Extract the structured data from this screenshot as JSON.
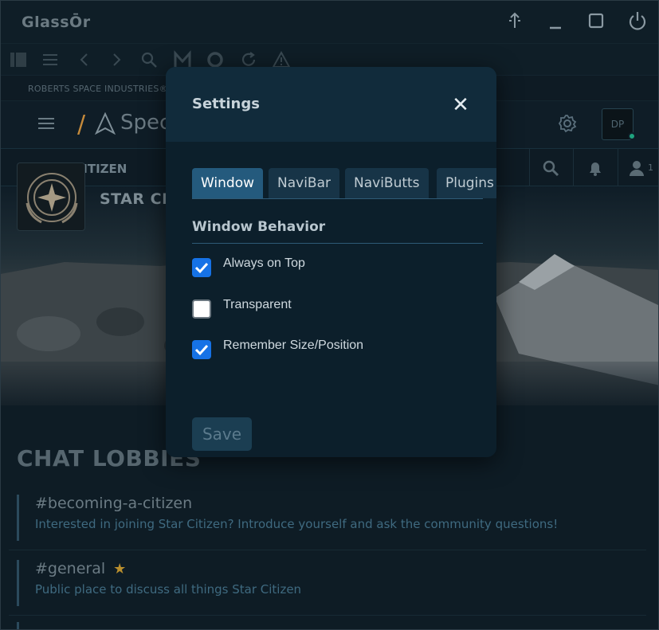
{
  "window": {
    "title": "GlassŌr",
    "buttons": [
      "upload-icon",
      "minimize-icon",
      "maximize-icon",
      "power-icon"
    ]
  },
  "navbar": {
    "icons": [
      "sidebar-icon",
      "menu-icon",
      "back-icon",
      "forward-icon",
      "search-icon",
      "m-icon",
      "circle-icon",
      "reload-icon",
      "warning-icon"
    ]
  },
  "site": {
    "rsi_label": "ROBERTS SPACE INDUSTRIES®",
    "app_name": "Spec",
    "avatar_initials": "DP",
    "community": "STAR CITIZEN",
    "member_count": "1",
    "banner_name": "STAR CIT"
  },
  "lobbies": {
    "title": "CHAT LOBBIES",
    "items": [
      {
        "name": "#becoming-a-citizen",
        "desc": "Interested in joining Star Citizen? Introduce yourself and ask the community questions!"
      },
      {
        "name": "#general",
        "desc": "Public place to discuss all things Star Citizen"
      }
    ]
  },
  "dialog": {
    "title": "Settings",
    "tabs": [
      "Window",
      "NaviBar",
      "NaviButts",
      "Plugins"
    ],
    "active_tab": "Window",
    "section_title": "Window Behavior",
    "options": [
      {
        "label": "Always on Top",
        "checked": true
      },
      {
        "label": "Transparent",
        "checked": false
      },
      {
        "label": "Remember Size/Position",
        "checked": true
      }
    ],
    "save_label": "Save"
  },
  "colors": {
    "accent": "#1672e6",
    "tab_active": "#245a7d",
    "dialog_bg": "#0c1f2b",
    "online": "#1fa37f"
  }
}
